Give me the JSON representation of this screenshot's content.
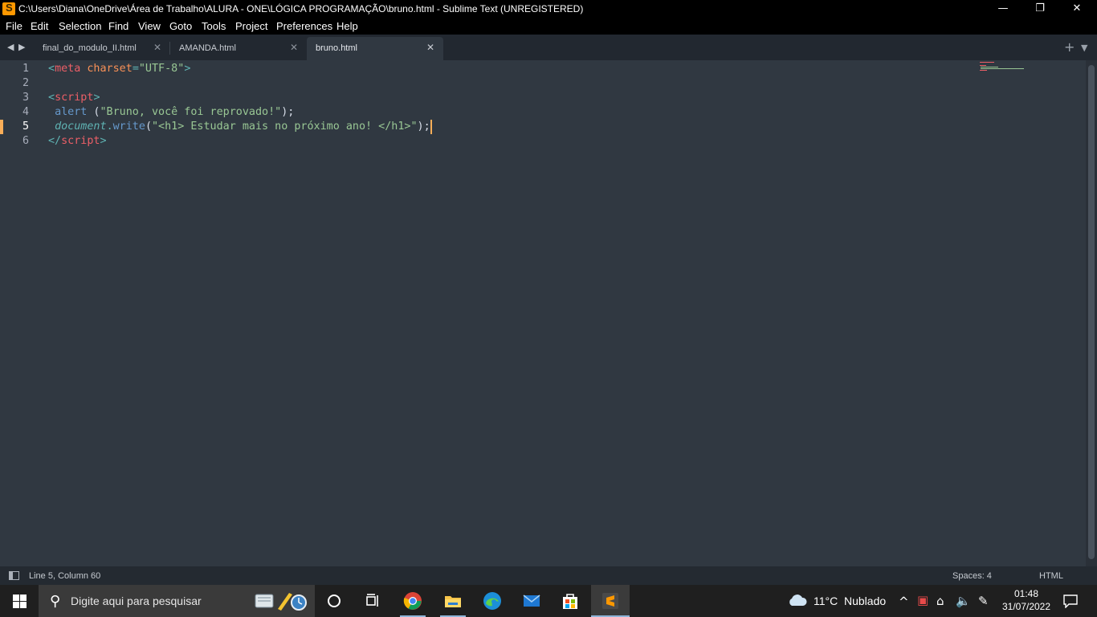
{
  "titlebar": {
    "title": "C:\\Users\\Diana\\OneDrive\\Área de Trabalho\\ALURA - ONE\\LÓGICA PROGRAMAÇÃO\\bruno.html - Sublime Text (UNREGISTERED)",
    "minimize": "—",
    "maximize": "❐",
    "close": "✕"
  },
  "menu": [
    "File",
    "Edit",
    "Selection",
    "Find",
    "View",
    "Goto",
    "Tools",
    "Project",
    "Preferences",
    "Help"
  ],
  "tabs": [
    {
      "label": "final_do_modulo_II.html",
      "active": false
    },
    {
      "label": "AMANDA.html",
      "active": false
    },
    {
      "label": "bruno.html",
      "active": true
    }
  ],
  "tab_close_glyph": "✕",
  "editor": {
    "line_numbers": [
      "1",
      "2",
      "3",
      "4",
      "5",
      "6"
    ],
    "current_line": 5,
    "lines": {
      "l1": {
        "lt": "<",
        "tag": "meta",
        "attr": " charset",
        "eq": "=",
        "val": "\"UTF-8\"",
        "gt": ">"
      },
      "l3": {
        "lt": "<",
        "tag": "script",
        "gt": ">"
      },
      "l4": {
        "indent": " ",
        "fn": "alert",
        "open": " (",
        "str": "\"Bruno, você foi reprovado!\"",
        "close": ");"
      },
      "l5": {
        "indent": " ",
        "obj": "document",
        "dot": ".",
        "meth": "write",
        "open": "(",
        "str": "\"<h1> Estudar mais no próximo ano! </h1>\"",
        "close": ");"
      },
      "l6": {
        "lt": "</",
        "tag": "script",
        "gt": ">"
      }
    }
  },
  "statusbar": {
    "position": "Line 5, Column 60",
    "indentation": "Spaces: 4",
    "syntax": "HTML"
  },
  "taskbar": {
    "search_placeholder": "Digite aqui para pesquisar",
    "weather_temp": "11°C",
    "weather_desc": "Nublado",
    "time": "01:48",
    "date": "31/07/2022"
  },
  "colors": {
    "editor_bg": "#303841",
    "tag": "#ec5f67",
    "attr": "#f99157",
    "string": "#99c794",
    "punctuation": "#5fb3b3",
    "cursor": "#f9ae58"
  }
}
